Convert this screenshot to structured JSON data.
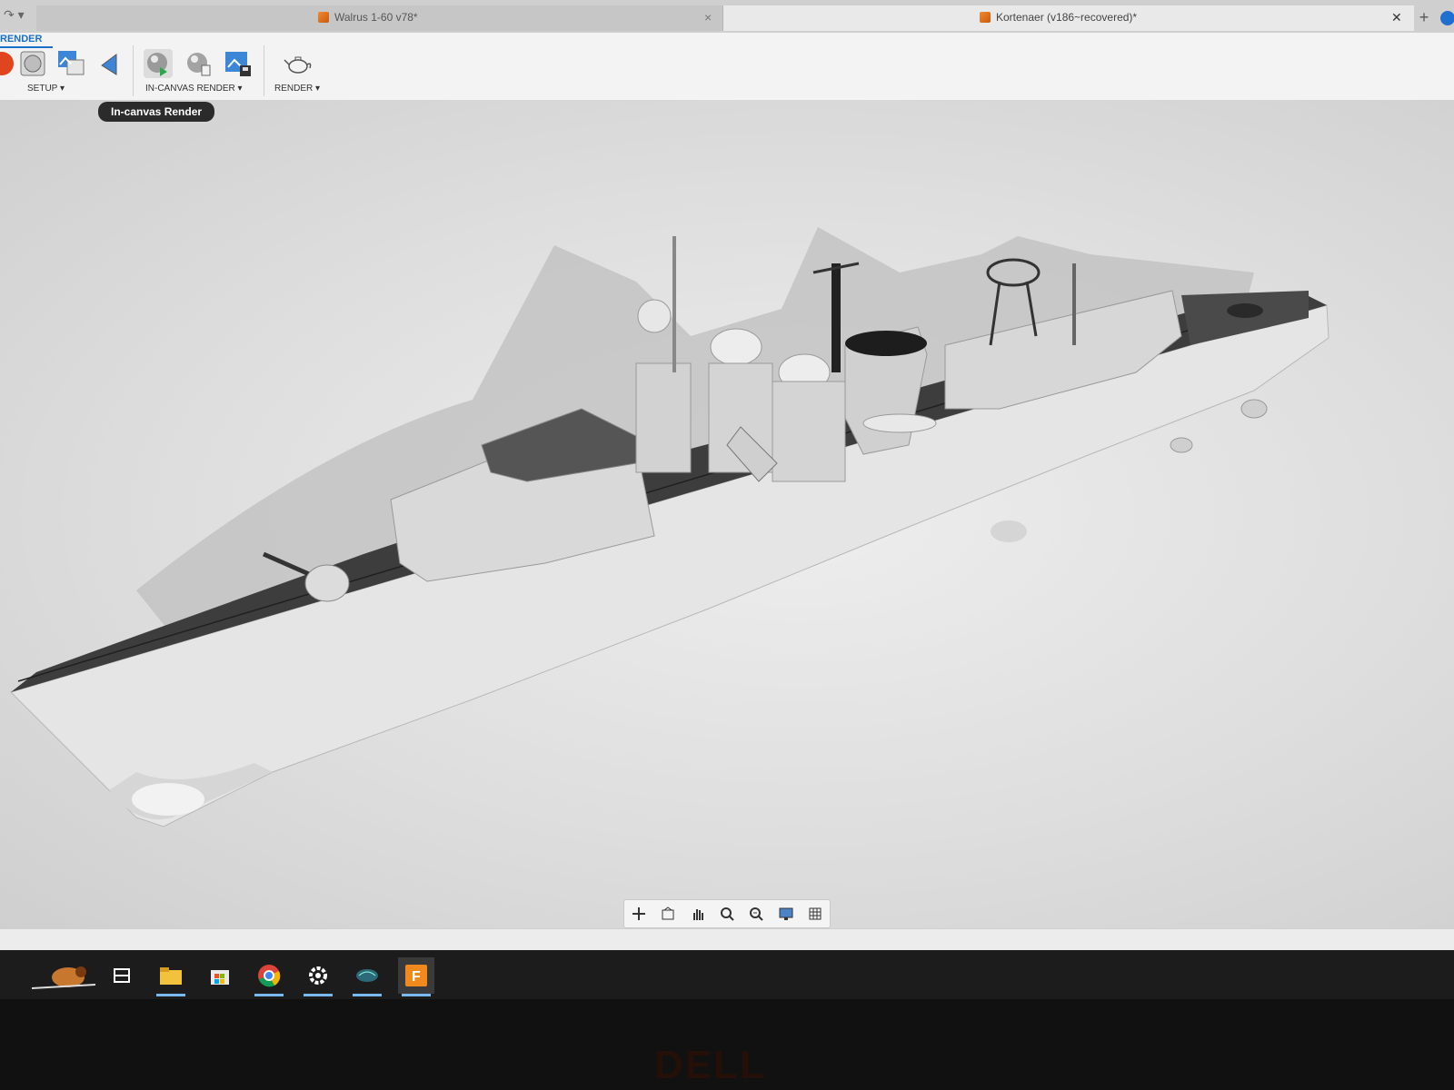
{
  "tabs": [
    {
      "label": "Walrus 1-60 v78*",
      "active": false
    },
    {
      "label": "Kortenaer (v186~recovered)*",
      "active": true
    }
  ],
  "ribbon": {
    "workspace": "RENDER",
    "groups": {
      "setup": "SETUP ▾",
      "in_canvas": "IN-CANVAS RENDER ▾",
      "render": "RENDER ▾"
    }
  },
  "tooltip": "In-canvas Render",
  "icons": {
    "undo": "redo-arrow-icon",
    "scene": "scene-settings-icon",
    "texture": "texture-map-icon",
    "decal": "decal-icon",
    "in_canvas_render": "in-canvas-render-icon",
    "in_canvas_settings": "in-canvas-render-settings-icon",
    "capture": "capture-image-icon",
    "render": "teapot-render-icon"
  },
  "colors": {
    "accent": "#1a6fc9",
    "tab_icon": "#f28a2e",
    "taskbar": "#1c1c1c"
  },
  "navbar": [
    "orbit-icon",
    "look-at-icon",
    "pan-icon",
    "zoom-icon",
    "fit-icon",
    "display-settings-icon",
    "grid-settings-icon"
  ],
  "taskbar": [
    "start-bird-icon",
    "task-view-icon",
    "file-explorer-icon",
    "store-icon",
    "chrome-icon",
    "settings-icon",
    "app-icon",
    "fusion360-icon"
  ],
  "bezel": "DELL"
}
